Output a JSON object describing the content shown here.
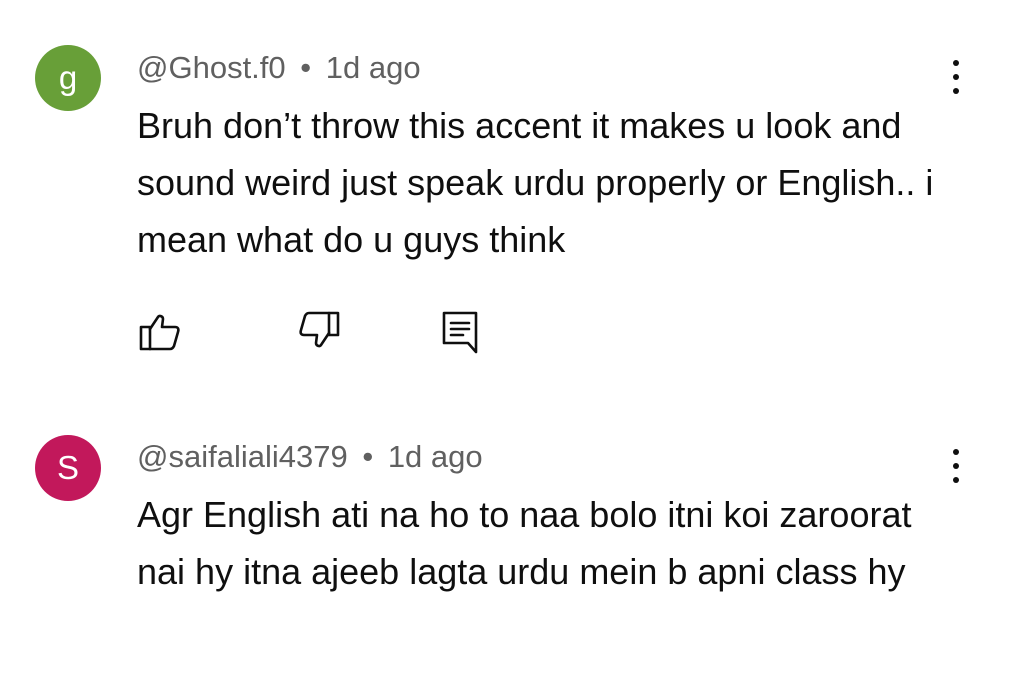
{
  "comments": [
    {
      "avatar_letter": "g",
      "avatar_color": "#689f38",
      "handle": "@Ghost.f0",
      "separator": "•",
      "time": "1d ago",
      "text": "Bruh don’t throw this accent it makes u look and sound weird just speak urdu properly or English.. i mean what do u guys think"
    },
    {
      "avatar_letter": "S",
      "avatar_color": "#c2185b",
      "handle": "@saifaliali4379",
      "separator": "•",
      "time": "1d ago",
      "text": "Agr English ati na ho to naa bolo itni koi zaroorat nai hy  itna ajeeb lagta urdu mein b apni class hy"
    }
  ],
  "actions": {
    "like_icon": "thumbs-up-icon",
    "dislike_icon": "thumbs-down-icon",
    "reply_icon": "reply-comment-icon",
    "menu_icon": "more-vertical-icon"
  }
}
